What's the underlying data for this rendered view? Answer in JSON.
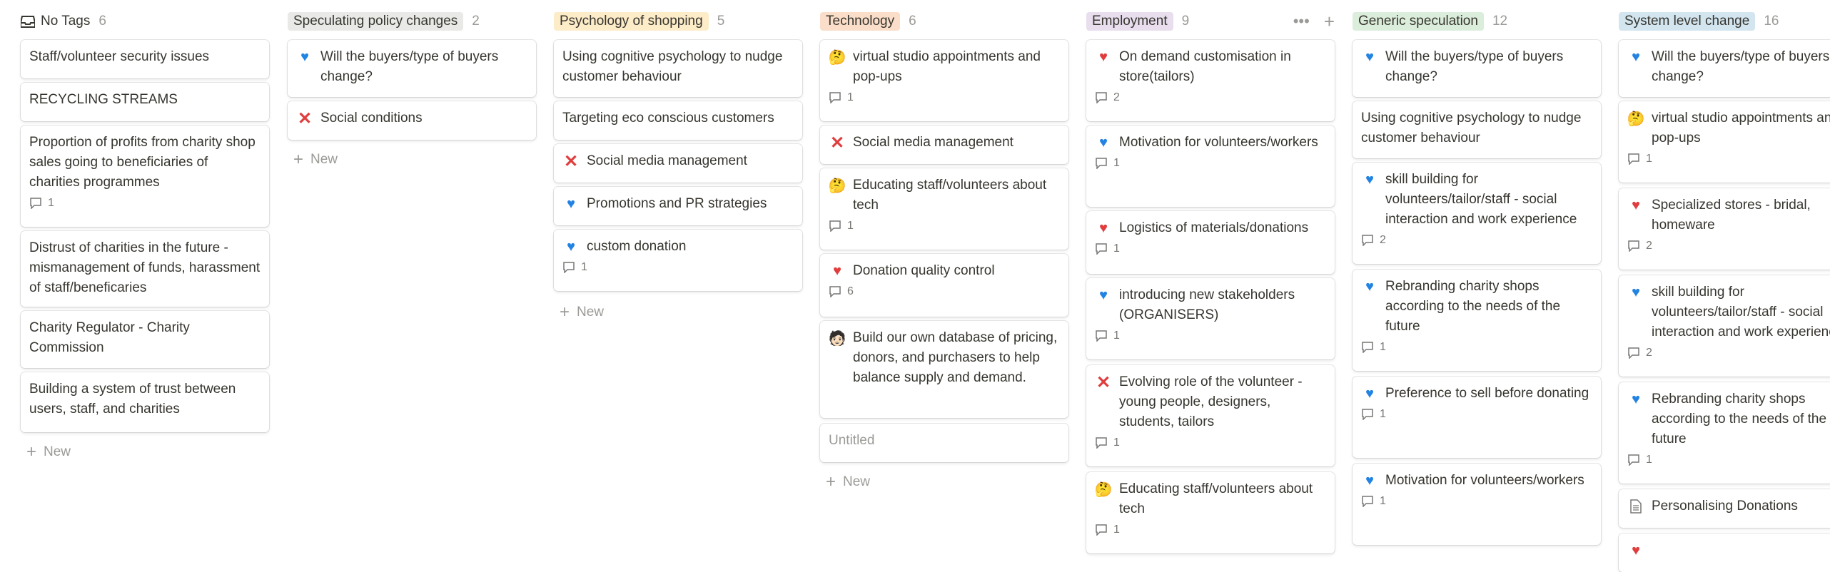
{
  "columns": [
    {
      "title": "No Tags",
      "count": "6",
      "icon": "inbox-icon",
      "cards": [
        {
          "title": "Staff/volunteer security issues"
        },
        {
          "title": "RECYCLING STREAMS"
        },
        {
          "title": "Proportion of profits from charity shop sales going to beneficiaries of charities programmes",
          "comments": "1"
        },
        {
          "title": "Distrust of charities in the future - mismanagement of funds, harassment of staff/beneficaries"
        },
        {
          "title": "Charity Regulator - Charity Commission"
        },
        {
          "title": "Building a system of trust between users, staff, and charities"
        }
      ],
      "new_label": "New"
    },
    {
      "title": "Speculating policy changes",
      "count": "2",
      "color": "#e9e9e7",
      "cards": [
        {
          "title": "Will the buyers/type of buyers change?",
          "icon": "blue-heart-icon"
        },
        {
          "title": "Social conditions",
          "icon": "cross-mark-icon"
        }
      ],
      "new_label": "New"
    },
    {
      "title": "Psychology of shopping",
      "count": "5",
      "color": "#fdecc8",
      "cards": [
        {
          "title": "Using cognitive psychology to nudge customer behaviour"
        },
        {
          "title": "Targeting eco conscious customers"
        },
        {
          "title": "Social media management",
          "icon": "cross-mark-icon"
        },
        {
          "title": "Promotions and PR strategies",
          "icon": "blue-heart-icon"
        },
        {
          "title": "custom donation",
          "icon": "blue-heart-icon",
          "comments": "1"
        }
      ],
      "new_label": "New"
    },
    {
      "title": "Technology",
      "count": "6",
      "color": "#fadec9",
      "cards": [
        {
          "title": "virtual studio appointments and pop-ups",
          "icon": "thinking-face-icon",
          "comments": "1"
        },
        {
          "title": "Social media management",
          "icon": "cross-mark-icon"
        },
        {
          "title": "Educating staff/volunteers about tech",
          "icon": "thinking-face-icon",
          "comments": "1"
        },
        {
          "title": "Donation quality control",
          "icon": "red-heart-icon",
          "comments": "6"
        },
        {
          "title": "Build our own database of pricing, donors, and purchasers to help balance supply and demand.",
          "icon": "person-icon"
        },
        {
          "title": "Untitled",
          "untitled": true
        }
      ],
      "new_label": "New"
    },
    {
      "title": "Employment",
      "count": "9",
      "color": "#e8deee",
      "cards": [
        {
          "title": "On demand customisation in store(tailors)",
          "icon": "red-heart-icon",
          "comments": "2"
        },
        {
          "title": "Motivation for volunteers/workers",
          "icon": "blue-heart-icon",
          "comments": "1"
        },
        {
          "title": "Logistics of materials/donations",
          "icon": "red-heart-icon",
          "comments": "1"
        },
        {
          "title": "introducing new stakeholders (ORGANISERS)",
          "icon": "blue-heart-icon",
          "comments": "1"
        },
        {
          "title": "Evolving role of the volunteer - young people, designers, students, tailors",
          "icon": "cross-mark-icon",
          "comments": "1"
        },
        {
          "title": "Educating staff/volunteers about tech",
          "icon": "thinking-face-icon",
          "comments": "1"
        }
      ]
    },
    {
      "title": "Generic speculation",
      "count": "12",
      "color": "#dbeddb",
      "cards": [
        {
          "title": "Will the buyers/type of buyers change?",
          "icon": "blue-heart-icon"
        },
        {
          "title": "Using cognitive psychology to nudge customer behaviour"
        },
        {
          "title": "skill building for volunteers/tailor/staff - social interaction and work experience",
          "icon": "blue-heart-icon",
          "comments": "2"
        },
        {
          "title": "Rebranding charity shops according to the needs of the future",
          "icon": "blue-heart-icon",
          "comments": "1"
        },
        {
          "title": "Preference to sell before donating",
          "icon": "blue-heart-icon",
          "comments": "1"
        },
        {
          "title": "Motivation for volunteers/workers",
          "icon": "blue-heart-icon",
          "comments": "1"
        }
      ]
    },
    {
      "title": "System level change",
      "count": "16",
      "color": "#d3e5ef",
      "cards": [
        {
          "title": "Will the buyers/type of buyers change?",
          "icon": "blue-heart-icon"
        },
        {
          "title": "virtual studio appointments and pop-ups",
          "icon": "thinking-face-icon",
          "comments": "1"
        },
        {
          "title": "Specialized stores - bridal, homeware",
          "icon": "red-heart-icon",
          "comments": "2"
        },
        {
          "title": "skill building for volunteers/tailor/staff - social interaction and work experience",
          "icon": "blue-heart-icon",
          "comments": "2"
        },
        {
          "title": "Rebranding charity shops according to the needs of the future",
          "icon": "blue-heart-icon",
          "comments": "1"
        },
        {
          "title": "Personalising Donations",
          "icon": "document-icon"
        }
      ]
    }
  ]
}
